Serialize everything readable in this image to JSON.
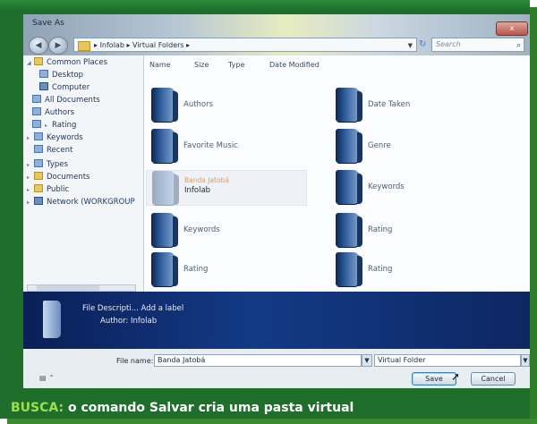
{
  "window": {
    "title": "Save As",
    "close_label": "x"
  },
  "address_bar": {
    "path": "Infolab ▸ Virtual Folders ▸",
    "breadcrumbs": [
      "Infolab",
      "Virtual Folders"
    ]
  },
  "search": {
    "placeholder": "Search"
  },
  "nav_pane": {
    "items": [
      {
        "label": "Common Places",
        "icon": "folder-icon"
      },
      {
        "label": "Desktop",
        "icon": "desktop-icon"
      },
      {
        "label": "Computer",
        "icon": "computer-icon"
      },
      {
        "label": "All Documents",
        "icon": "virtual-folder-icon"
      },
      {
        "label": "Authors",
        "icon": "virtual-folder-icon"
      },
      {
        "label": "Rating",
        "icon": "virtual-folder-icon"
      },
      {
        "label": "Keywords",
        "icon": "virtual-folder-icon"
      },
      {
        "label": "Recent",
        "icon": "virtual-folder-icon"
      },
      {
        "label": "Types",
        "icon": "virtual-folder-icon"
      },
      {
        "label": "Documents",
        "icon": "folder-icon"
      },
      {
        "label": "Public",
        "icon": "folder-icon"
      },
      {
        "label": "Network (WORKGROUP",
        "icon": "network-icon"
      }
    ]
  },
  "columns": [
    "Name",
    "Size",
    "Type",
    "Date Modified"
  ],
  "folders": [
    {
      "label": "Authors"
    },
    {
      "label": "Date Taken"
    },
    {
      "label": "Favorite Music"
    },
    {
      "label": "Genre"
    },
    {
      "label": "Banda Jatobá",
      "sublabel": "Infolab"
    },
    {
      "label": "Keywords"
    },
    {
      "label": "Keywords"
    },
    {
      "label": "Rating"
    },
    {
      "label": "Rating"
    },
    {
      "label": "Rating"
    }
  ],
  "details": {
    "line1": "File Descripti... Add a label",
    "line2": "Author: Infolab"
  },
  "file_name": {
    "label": "File name:",
    "value": "Banda Jatobá"
  },
  "save_as_type": {
    "value": "Virtual Folder"
  },
  "buttons": {
    "save": "Save",
    "cancel": "Cancel"
  },
  "caption": {
    "highlight": "BUSCA:",
    "text": " o comando Salvar cria uma pasta virtual"
  },
  "colors": {
    "frame": "#1f6e2c",
    "details_bg": "#133a86",
    "caption_highlight": "#9be04a"
  }
}
